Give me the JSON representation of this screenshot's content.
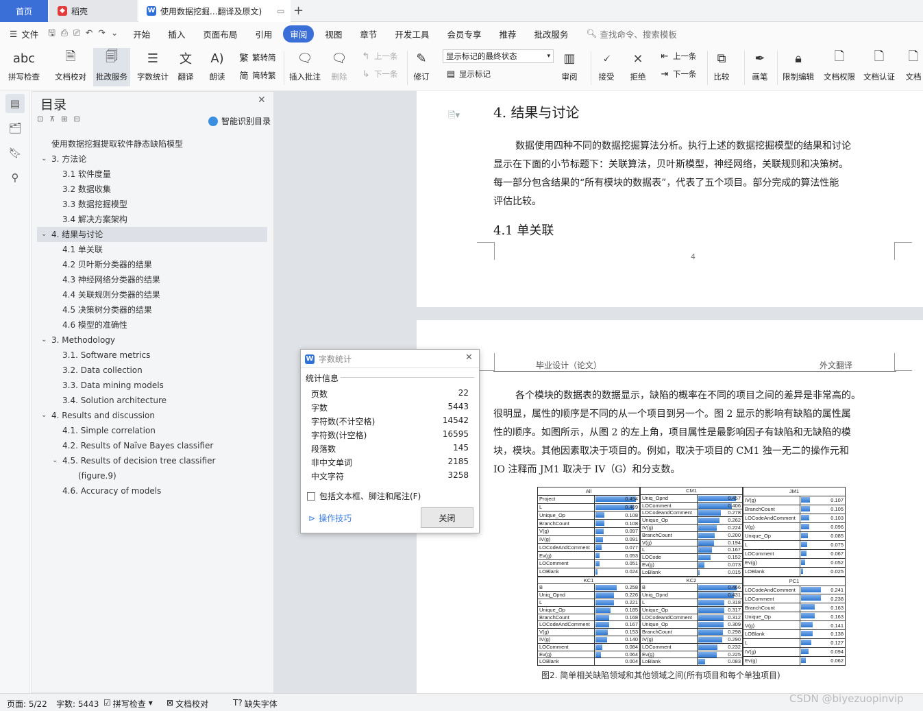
{
  "tabs": {
    "home": "首页",
    "daoke": "稻壳",
    "doc": "使用数据挖掘...翻译及原文)"
  },
  "menu": {
    "file": "文件",
    "items": [
      "开始",
      "插入",
      "页面布局",
      "引用",
      "审阅",
      "视图",
      "章节",
      "开发工具",
      "会员专享",
      "推荐",
      "批改服务"
    ],
    "active": "审阅",
    "search": "查找命令、搜索模板"
  },
  "ribbon": {
    "spell": "拼写检查",
    "proof": "文档校对",
    "correct": "批改服务",
    "wordcount": "字数统计",
    "translate": "翻译",
    "read": "朗读",
    "trad": "繁转简",
    "simp": "简转繁",
    "add_comment": "插入批注",
    "delete": "删除",
    "prev": "上一条",
    "next": "下一条",
    "revise": "修订",
    "markup_state": "显示标记的最终状态",
    "show_markup": "显示标记",
    "review": "审阅",
    "accept": "接受",
    "reject": "拒绝",
    "prev2": "上一条",
    "next2": "下一条",
    "compare": "比较",
    "pen": "画笔",
    "restrict": "限制编辑",
    "doc_perm": "文档权限",
    "doc_auth": "文档认证",
    "doc_more": "文档"
  },
  "toc": {
    "title": "目录",
    "smart": "智能识别目录",
    "items": [
      "使用数据挖掘提取软件静态缺陷模型",
      "3. 方法论",
      "3.1  软件度量",
      "3.2  数据收集",
      "3.3  数据挖掘模型",
      "3.4  解决方案架构",
      "4.  结果与讨论",
      "4.1  单关联",
      "4.2  贝叶斯分类器的结果",
      "4.3  神经网络分类器的结果",
      "4.4  关联规则分类器的结果",
      "4.5  决策树分类器的结果",
      "4.6  模型的准确性",
      "3. Methodology",
      "3.1. Software metrics",
      "3.2. Data collection",
      "3.3. Data mining models",
      "3.4. Solution architecture",
      "4. Results and discussion",
      "4.1. Simple correlation",
      "4.2. Results of Naïve Bayes classifier",
      "4.5. Results of decision tree classifier",
      "(figure.9)",
      "4.6. Accuracy of models"
    ]
  },
  "page1": {
    "heading": "4.  结果与讨论",
    "para": [
      "数据使用四种不同的数据挖掘算法分析。执行上述的数据挖掘模型的结果和讨论",
      "显示在下面的小节标题下：关联算法，贝叶斯模型，神经网络，关联规则和决策树。",
      "每一部分包含结果的“所有模块的数据表”，代表了五个项目。部分完成的算法性能",
      "评估比较。"
    ],
    "sub": "4.1  单关联",
    "pageno": "4"
  },
  "page2": {
    "header_left": "毕业设计（论文）",
    "header_right": "外文翻译",
    "para": [
      "各个模块的数据表的数据显示，缺陷的概率在不同的项目之间的差异是非常高的。",
      "很明显，属性的顺序是不同的从一个项目到另一个。图 2 显示的影响有缺陷的属性属",
      "性的顺序。如图所示，从图 2 的左上角，项目属性是最影响因子有缺陷和无缺陷的模",
      "块，模块。其他因素取决于项目的。例如，取决于项目的 CM1 独一无二的操作元和",
      "IO 注释而 JM1 取决于 IV（G）和分支数。"
    ],
    "caption": "图2. 简单相关缺陷领域和其他领域之间(所有项目和每个单独项目)"
  },
  "figure": {
    "top": [
      {
        "title": "All",
        "rows": [
          [
            "Project",
            0.494
          ],
          [
            "L",
            0.469
          ],
          [
            "Unique_Op",
            0.108
          ],
          [
            "BranchCount",
            0.108
          ],
          [
            "V(g)",
            0.097
          ],
          [
            "IV(g)",
            0.091
          ],
          [
            "LOCodeAndComment",
            0.077
          ],
          [
            "Ev(g)",
            0.053
          ],
          [
            "LOComment",
            0.051
          ],
          [
            "LOBlank",
            0.024
          ]
        ]
      },
      {
        "title": "CM1",
        "rows": [
          [
            "Uniq_Opnd",
            0.457
          ],
          [
            "LOComment",
            0.406
          ],
          [
            "LOCodeandComment",
            0.278
          ],
          [
            "Unique_Op",
            0.262
          ],
          [
            "IV(g)",
            0.224
          ],
          [
            "BranchCount",
            0.2
          ],
          [
            "V(g)",
            0.194
          ],
          [
            "L",
            0.167
          ],
          [
            "LOCode",
            0.152
          ],
          [
            "Ev(g)",
            0.073
          ],
          [
            "LoBlank",
            0.015
          ]
        ]
      },
      {
        "title": "JM1",
        "rows": [
          [
            "IV(g)",
            0.107
          ],
          [
            "BranchCount",
            0.105
          ],
          [
            "LOCodeAndComment",
            0.103
          ],
          [
            "V(g)",
            0.096
          ],
          [
            "Unique_Op",
            0.085
          ],
          [
            "L",
            0.075
          ],
          [
            "LOComment",
            0.067
          ],
          [
            "Ev(g)",
            0.052
          ],
          [
            "LOBlank",
            0.025
          ]
        ]
      }
    ],
    "bottom": [
      {
        "title": "KC1",
        "rows": [
          [
            "B",
            0.258
          ],
          [
            "Uniq_Opnd",
            0.226
          ],
          [
            "L",
            0.221
          ],
          [
            "Unique_Op",
            0.185
          ],
          [
            "BranchCount",
            0.168
          ],
          [
            "LOCodeAndComment",
            0.167
          ],
          [
            "V(g)",
            0.153
          ],
          [
            "IV(g)",
            0.14
          ],
          [
            "LOComment",
            0.084
          ],
          [
            "Ev(g)",
            0.064
          ],
          [
            "LOBlank",
            0.004
          ]
        ]
      },
      {
        "title": "KC2",
        "rows": [
          [
            "B",
            0.466
          ],
          [
            "Uniq_Opnd",
            0.431
          ],
          [
            "L",
            0.318
          ],
          [
            "Unique_Op",
            0.317
          ],
          [
            "LOCodeandComment",
            0.312
          ],
          [
            "Unique_Op",
            0.309
          ],
          [
            "BranchCount",
            0.298
          ],
          [
            "IV(g)",
            0.29
          ],
          [
            "LOComment",
            0.232
          ],
          [
            "Ev(g)",
            0.225
          ],
          [
            "LoBlank",
            0.083
          ]
        ]
      },
      {
        "title": "PC1",
        "rows": [
          [
            "LOCodeAndComment",
            0.241
          ],
          [
            "LOComment",
            0.238
          ],
          [
            "BranchCount",
            0.163
          ],
          [
            "Unique_Op",
            0.163
          ],
          [
            "V(g)",
            0.141
          ],
          [
            "LOBlank",
            0.138
          ],
          [
            "L",
            0.127
          ],
          [
            "IV(g)",
            0.094
          ],
          [
            "Ev(g)",
            0.062
          ]
        ]
      }
    ]
  },
  "dialog": {
    "title": "字数统计",
    "section": "统计信息",
    "rows": [
      [
        "页数",
        "22"
      ],
      [
        "字数",
        "5443"
      ],
      [
        "字符数(不计空格)",
        "14542"
      ],
      [
        "字符数(计空格)",
        "16595"
      ],
      [
        "段落数",
        "145"
      ],
      [
        "非中文单词",
        "2185"
      ],
      [
        "中文字符",
        "3258"
      ]
    ],
    "checkbox": "包括文本框、脚注和尾注(F)",
    "tips": "操作技巧",
    "close": "关闭"
  },
  "status": {
    "page": "页面: 5/22",
    "words": "字数: 5443",
    "spell": "拼写检查",
    "proof": "文档校对",
    "font": "缺失字体",
    "watermark": "CSDN @biyezuopinvip"
  }
}
